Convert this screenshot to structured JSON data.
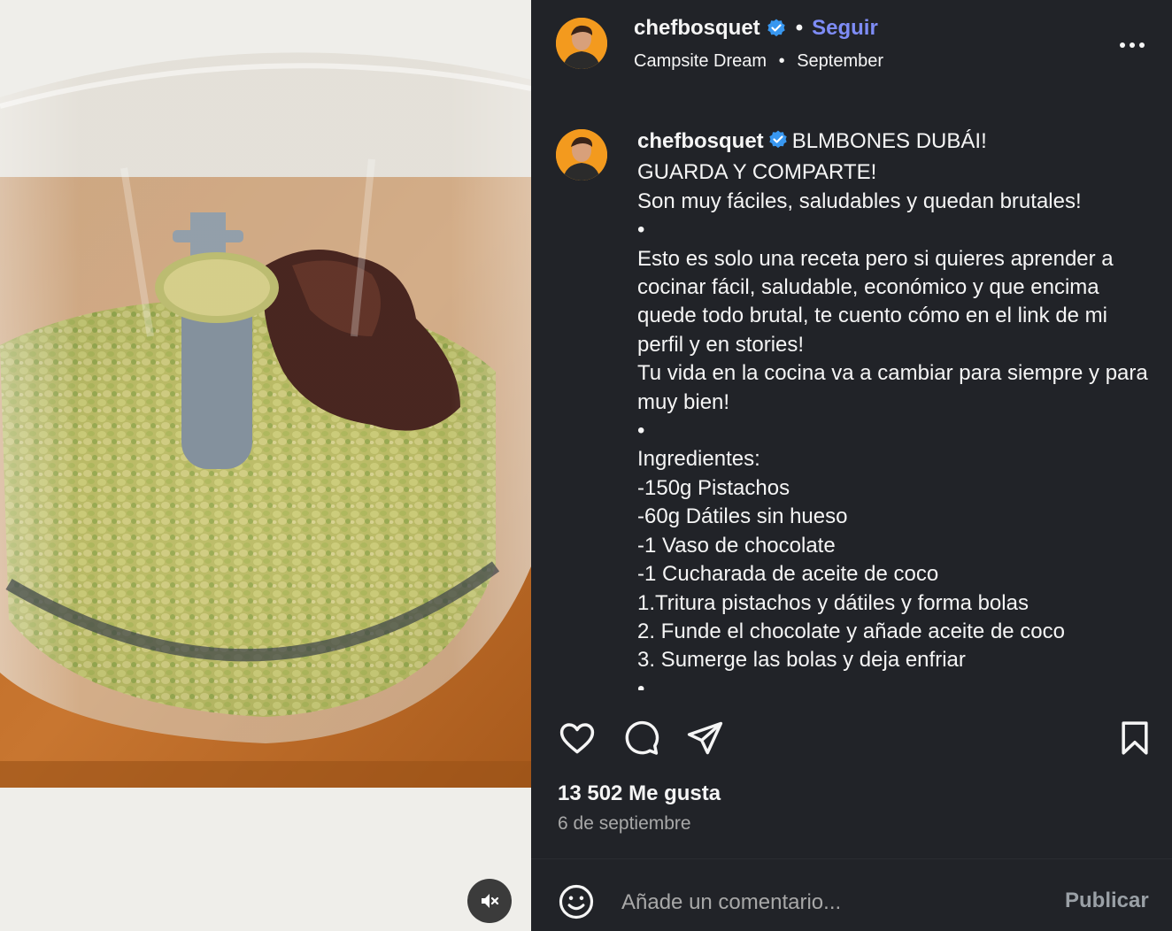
{
  "header": {
    "username": "chefbosquet",
    "follow_label": "Seguir",
    "location": "Campsite Dream",
    "audio": "September",
    "separator": "•"
  },
  "caption": {
    "username": "chefbosquet",
    "text": "BLMBONES DUBÁI!\nGUARDA Y COMPARTE!\nSon muy fáciles, saludables y quedan brutales!\n•\nEsto es solo una receta pero si quieres aprender a cocinar fácil, saludable, económico y que encima quede todo brutal, te cuento cómo en el link de mi perfil y en stories!\nTu vida en la cocina va a cambiar para siempre y para muy bien!\n•\nIngredientes:\n-150g Pistachos\n-60g Dátiles sin hueso\n-1 Vaso de chocolate\n-1 Cucharada de aceite de coco\n1.Tritura pistachos y dátiles y forma bolas\n2. Funde el chocolate y añade aceite de coco\n3. Sumerge las bolas y deja enfriar\n•"
  },
  "stats": {
    "likes": "13 502 Me gusta",
    "date": "6 de septiembre"
  },
  "comment": {
    "placeholder": "Añade un comentario...",
    "publish_label": "Publicar"
  },
  "icons": {
    "verified": "verified-badge-icon",
    "more": "more-options-icon",
    "like": "heart-icon",
    "comment": "comment-bubble-icon",
    "share": "paper-plane-icon",
    "save": "bookmark-icon",
    "emoji": "emoji-smiley-icon",
    "mute": "speaker-muted-icon"
  },
  "colors": {
    "panel_bg": "#212328",
    "follow": "#7e8cf6",
    "verified": "#3897f0",
    "muted_text": "#a8a8a8"
  }
}
